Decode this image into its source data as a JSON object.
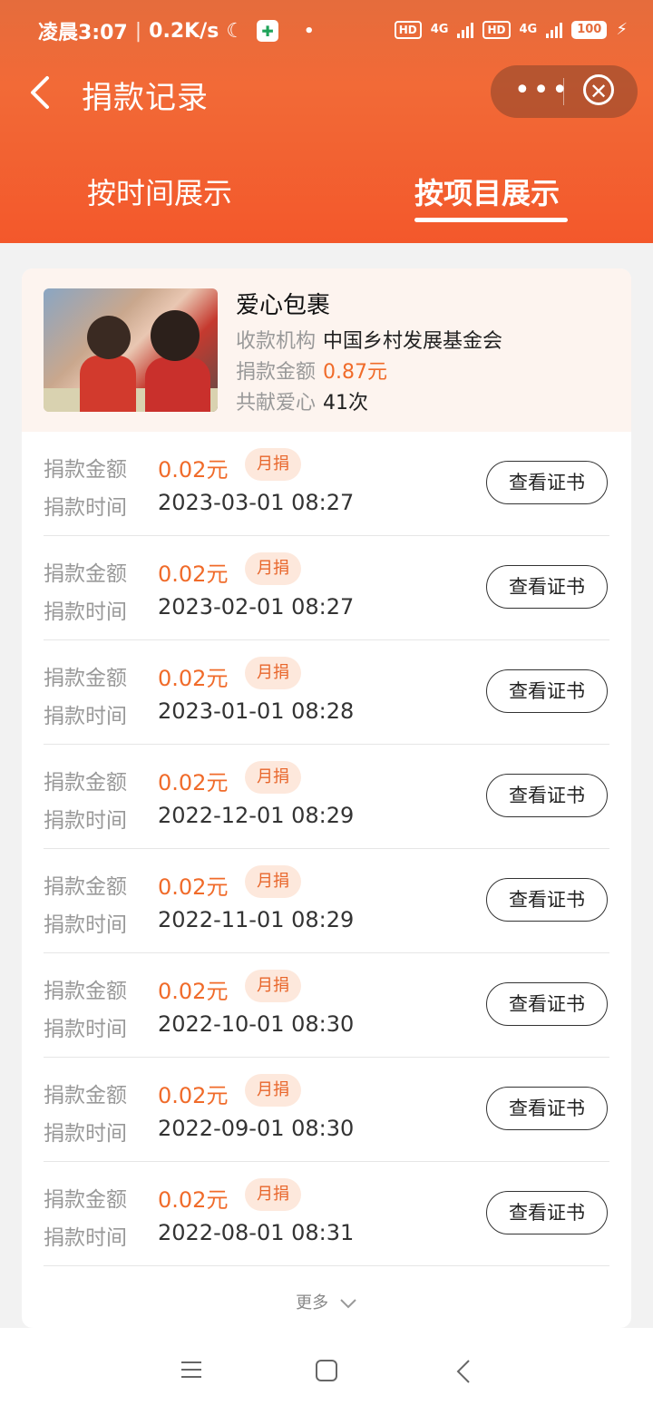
{
  "status_bar": {
    "time": "凌晨3:07",
    "speed": "0.2K/s",
    "hd1": "HD",
    "net1": "4G",
    "hd2": "HD",
    "net2": "4G",
    "battery": "100"
  },
  "nav": {
    "title": "捐款记录",
    "more_icon": "more-dots-icon",
    "close_icon": "close-circle-icon"
  },
  "tabs": [
    {
      "label": "按时间展示",
      "active": false
    },
    {
      "label": "按项目展示",
      "active": true
    }
  ],
  "project": {
    "title": "爱心包裹",
    "org_label": "收款机构",
    "org_value": "中国乡村发展基金会",
    "amount_label": "捐款金额",
    "amount_value": "0.87元",
    "count_label": "共献爱心",
    "count_value": "41次"
  },
  "records": [
    {
      "amount_label": "捐款金额",
      "amount": "0.02元",
      "badge": "月捐",
      "time_label": "捐款时间",
      "time": "2023-03-01 08:27",
      "button": "查看证书"
    },
    {
      "amount_label": "捐款金额",
      "amount": "0.02元",
      "badge": "月捐",
      "time_label": "捐款时间",
      "time": "2023-02-01 08:27",
      "button": "查看证书"
    },
    {
      "amount_label": "捐款金额",
      "amount": "0.02元",
      "badge": "月捐",
      "time_label": "捐款时间",
      "time": "2023-01-01 08:28",
      "button": "查看证书"
    },
    {
      "amount_label": "捐款金额",
      "amount": "0.02元",
      "badge": "月捐",
      "time_label": "捐款时间",
      "time": "2022-12-01 08:29",
      "button": "查看证书"
    },
    {
      "amount_label": "捐款金额",
      "amount": "0.02元",
      "badge": "月捐",
      "time_label": "捐款时间",
      "time": "2022-11-01 08:29",
      "button": "查看证书"
    },
    {
      "amount_label": "捐款金额",
      "amount": "0.02元",
      "badge": "月捐",
      "time_label": "捐款时间",
      "time": "2022-10-01 08:30",
      "button": "查看证书"
    },
    {
      "amount_label": "捐款金额",
      "amount": "0.02元",
      "badge": "月捐",
      "time_label": "捐款时间",
      "time": "2022-09-01 08:30",
      "button": "查看证书"
    },
    {
      "amount_label": "捐款金额",
      "amount": "0.02元",
      "badge": "月捐",
      "time_label": "捐款时间",
      "time": "2022-08-01 08:31",
      "button": "查看证书"
    }
  ],
  "more": {
    "label": "更多"
  },
  "colors": {
    "accent": "#f06b2a",
    "header": "#f3582b",
    "badge_bg": "#fde8dc"
  }
}
